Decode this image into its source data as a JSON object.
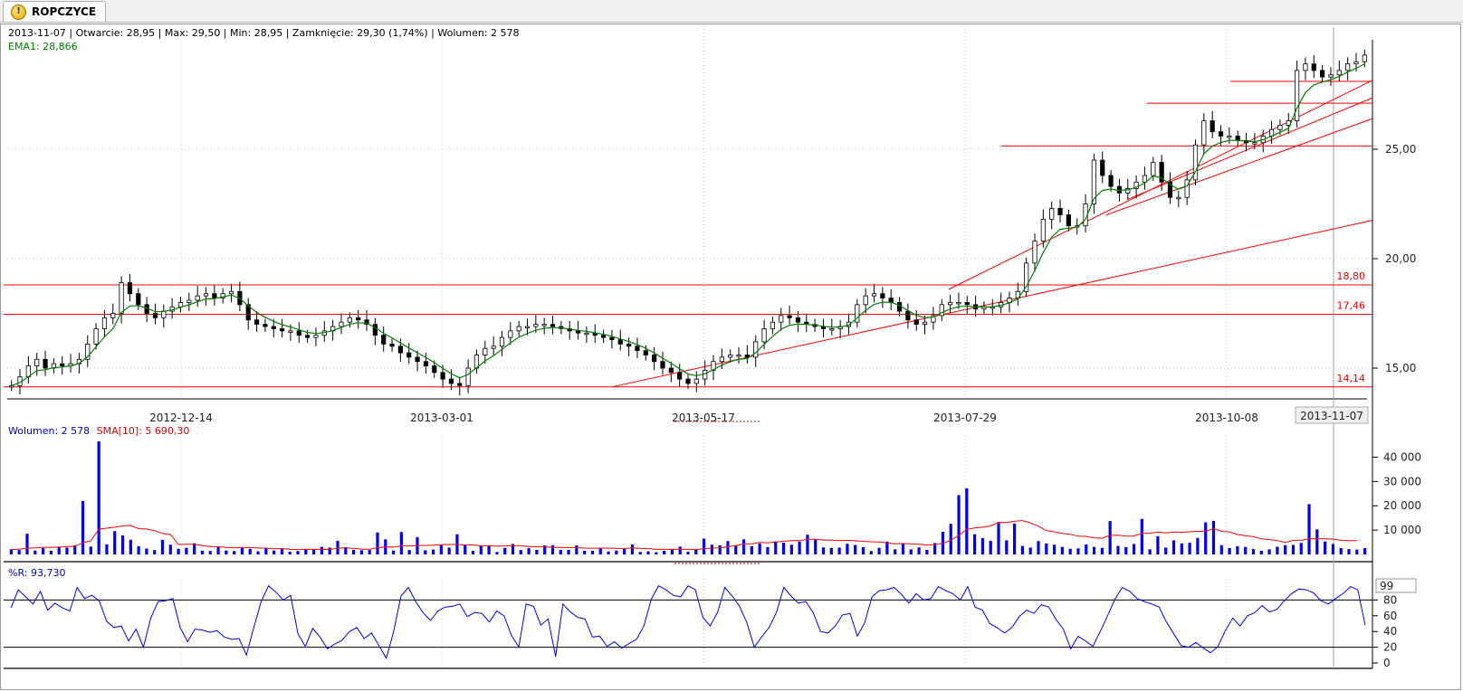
{
  "tab": {
    "icon": "warning-icon",
    "title": "ROPCZYCE"
  },
  "price_info": "2013-11-07 | Otwarcie: 28,95 | Max: 29,50 | Min: 28,95 | Zamknięcie: 29,30 (1,74%) | Wolumen: 2 578",
  "ema_label": "EMA1: 28,866",
  "volume_info": {
    "volume": "Wolumen: 2 578",
    "sma": "SMA[10]: 5 690,30"
  },
  "wr_label": "%R: 93,730",
  "wr_current_box": "99",
  "colors": {
    "ema": "#008000",
    "lines": "#ff0000",
    "volume": "#0000ee",
    "sma": "#ff0000",
    "wr": "#0000ee"
  },
  "chart_data": [
    {
      "type": "candlestick",
      "title": "ROPCZYCE",
      "x_dates": [
        "2012-12-14",
        "2013-03-01",
        "2013-05-17",
        "2013-07-29",
        "2013-10-08",
        "2013-11-07"
      ],
      "y_ticks": [
        "15,00",
        "20,00",
        "25,00"
      ],
      "ylim": [
        13.3,
        30.8
      ],
      "levels": [
        {
          "value": 18.8,
          "label": "18,80"
        },
        {
          "value": 17.46,
          "label": "17,46"
        },
        {
          "value": 14.14,
          "label": "14,14"
        }
      ],
      "close": [
        14.2,
        14.6,
        15.1,
        15.4,
        15.0,
        15.2,
        15.1,
        15.2,
        15.4,
        16.1,
        16.8,
        17.3,
        17.5,
        18.9,
        18.4,
        17.9,
        17.5,
        17.3,
        17.6,
        17.8,
        18.0,
        18.1,
        18.3,
        18.4,
        18.2,
        18.4,
        18.5,
        17.9,
        17.2,
        17.0,
        16.9,
        16.8,
        16.7,
        16.7,
        16.5,
        16.4,
        16.5,
        16.7,
        16.9,
        17.1,
        17.3,
        17.2,
        17.0,
        16.5,
        16.1,
        16.0,
        15.7,
        15.5,
        15.3,
        15.1,
        14.8,
        14.5,
        14.3,
        14.2,
        15.0,
        15.6,
        15.9,
        16.0,
        16.4,
        16.7,
        16.9,
        16.9,
        17.0,
        17.0,
        16.9,
        16.8,
        16.7,
        16.6,
        16.6,
        16.5,
        16.4,
        16.3,
        16.1,
        16.0,
        15.8,
        15.6,
        15.3,
        15.0,
        14.8,
        14.5,
        14.3,
        14.5,
        14.9,
        15.3,
        15.5,
        15.6,
        15.6,
        15.5,
        16.2,
        16.8,
        17.1,
        17.4,
        17.3,
        17.1,
        17.0,
        16.9,
        16.8,
        16.8,
        16.9,
        17.1,
        17.9,
        18.3,
        18.4,
        18.2,
        18.0,
        17.6,
        17.2,
        17.0,
        17.1,
        17.4,
        17.9,
        18.0,
        18.0,
        17.9,
        17.7,
        17.8,
        17.8,
        18.0,
        18.2,
        18.5,
        19.8,
        20.8,
        21.8,
        22.3,
        22.0,
        21.5,
        21.5,
        22.5,
        24.5,
        23.8,
        23.3,
        23.0,
        23.2,
        23.5,
        23.8,
        24.4,
        23.5,
        22.8,
        22.8,
        23.6,
        25.2,
        26.3,
        25.8,
        25.6,
        25.6,
        25.4,
        25.3,
        25.3,
        25.6,
        25.9,
        26.1,
        26.3,
        28.6,
        28.9,
        28.6,
        28.3,
        28.4,
        28.6,
        28.9,
        29.0,
        29.3
      ],
      "indicator": {
        "name": "EMA1",
        "last": 28.866
      }
    },
    {
      "type": "bar",
      "title": "Wolumen",
      "y_ticks": [
        "10 000",
        "20 000",
        "30 000",
        "40 000"
      ],
      "ylim": [
        0,
        46500
      ],
      "values": [
        2100,
        1800,
        8500,
        1600,
        2600,
        1500,
        3100,
        2800,
        3700,
        22000,
        3200,
        48000,
        4100,
        9600,
        7800,
        6000,
        3400,
        2400,
        1800,
        6000,
        4000,
        2300,
        2700,
        4600,
        1500,
        1400,
        3000,
        1600,
        1400,
        3000,
        2300,
        1300,
        2800,
        1600,
        2400,
        1100,
        1400,
        2100,
        2000,
        3100,
        2800,
        5600,
        3000,
        1900,
        1700,
        1800,
        9000,
        6200,
        1600,
        9200,
        1800,
        7100,
        1700,
        2000,
        3800,
        2800,
        8300,
        4000,
        1500,
        3700,
        3500,
        1000,
        2700,
        4300,
        1800,
        2600,
        1900,
        3700,
        3800,
        1900,
        1900,
        3700,
        1500,
        1500,
        2600,
        1200,
        1600,
        2200,
        4100,
        1000,
        1300,
        900,
        1500,
        2200,
        3200,
        1100,
        1900,
        6500,
        4000,
        3800,
        5500,
        3700,
        6200,
        3400,
        4500,
        3000,
        5400,
        4800,
        4000,
        5300,
        8100,
        6300,
        2900,
        2700,
        2800,
        4400,
        3900,
        3000,
        1400,
        2700,
        5300,
        2100,
        4300,
        2100,
        2900,
        1900,
        4700,
        9300,
        12600,
        24400,
        27200,
        8300,
        6700,
        5600,
        13300,
        5800,
        12700,
        3500,
        2800,
        5500,
        4500,
        4000,
        3100,
        2300,
        2500,
        4100,
        3100,
        2700,
        13700,
        3500,
        3000,
        4300,
        14600,
        2100,
        7500,
        2800,
        5800,
        4500,
        4800,
        6800,
        13200,
        13800,
        3800,
        2600,
        3400,
        3100,
        2200,
        1500,
        2100,
        3200,
        3800,
        3900,
        4700,
        20700,
        10300,
        5300,
        4300,
        2600,
        2200,
        2000,
        2600
      ],
      "series": [
        {
          "name": "SMA[10]",
          "last": 5690.3
        }
      ],
      "sma_values": [
        2000,
        2200,
        2500,
        2700,
        2900,
        2900,
        3000,
        3200,
        3400,
        4800,
        5600,
        10400,
        10800,
        11200,
        11700,
        11900,
        10600,
        10400,
        9800,
        8600,
        8200,
        4100,
        4200,
        4200,
        3600,
        3200,
        3200,
        2900,
        2700,
        2900,
        2800,
        2600,
        2600,
        2300,
        2400,
        2100,
        2000,
        2100,
        2100,
        2100,
        2000,
        2600,
        2700,
        2500,
        2200,
        2100,
        2800,
        3100,
        3000,
        3500,
        3500,
        3700,
        3700,
        3800,
        4000,
        4100,
        4100,
        3900,
        3900,
        3500,
        3600,
        3400,
        3500,
        3700,
        3500,
        3200,
        3200,
        3100,
        2900,
        2900,
        2800,
        2800,
        2600,
        2500,
        2600,
        2600,
        2500,
        2400,
        2700,
        2500,
        2400,
        2100,
        2100,
        2100,
        2100,
        2100,
        2000,
        2300,
        2600,
        2700,
        3200,
        3600,
        4300,
        4400,
        4900,
        4800,
        5100,
        5400,
        5700,
        5700,
        6200,
        6200,
        5900,
        5900,
        5700,
        5800,
        5600,
        5400,
        5200,
        5100,
        4800,
        4400,
        4500,
        4300,
        4200,
        3900,
        4000,
        4600,
        5800,
        7800,
        10300,
        10900,
        11200,
        11700,
        13100,
        13100,
        13700,
        13900,
        13000,
        11600,
        9800,
        9300,
        8600,
        8300,
        7500,
        7400,
        6800,
        6700,
        7800,
        7900,
        7500,
        7600,
        8700,
        8700,
        9200,
        8800,
        9200,
        9100,
        9300,
        9500,
        9500,
        10600,
        9500,
        9300,
        8200,
        7700,
        7300,
        6400,
        6100,
        5700,
        4900,
        5800,
        5800,
        6400,
        6500,
        6400,
        6300,
        5800,
        5700,
        5700
      ]
    },
    {
      "type": "line",
      "title": "%R",
      "y_ticks": [
        "0",
        "20",
        "40",
        "60",
        "80"
      ],
      "ylim": [
        0,
        102
      ],
      "series": [
        {
          "name": "%R",
          "last": 93.73
        }
      ],
      "values": [
        70,
        93,
        84,
        75,
        91,
        67,
        76,
        70,
        66,
        96,
        82,
        86,
        79,
        53,
        45,
        47,
        28,
        43,
        20,
        57,
        78,
        79,
        82,
        45,
        27,
        43,
        42,
        39,
        41,
        33,
        30,
        31,
        10,
        45,
        78,
        98,
        90,
        80,
        86,
        37,
        21,
        44,
        33,
        18,
        24,
        29,
        40,
        45,
        31,
        38,
        22,
        6,
        40,
        85,
        96,
        78,
        64,
        54,
        66,
        71,
        72,
        75,
        59,
        64,
        63,
        52,
        66,
        60,
        35,
        20,
        75,
        72,
        48,
        56,
        8,
        75,
        65,
        58,
        56,
        33,
        34,
        21,
        27,
        19,
        25,
        30,
        47,
        81,
        98,
        93,
        86,
        84,
        98,
        93,
        58,
        47,
        64,
        96,
        85,
        72,
        51,
        20,
        33,
        45,
        64,
        96,
        85,
        76,
        78,
        64,
        40,
        38,
        47,
        61,
        63,
        34,
        51,
        84,
        92,
        93,
        96,
        87,
        76,
        88,
        80,
        82,
        97,
        92,
        88,
        80,
        97,
        71,
        67,
        50,
        45,
        38,
        45,
        59,
        67,
        63,
        74,
        71,
        55,
        43,
        18,
        34,
        28,
        21,
        40,
        60,
        81,
        96,
        91,
        82,
        78,
        75,
        71,
        52,
        37,
        22,
        20,
        26,
        19,
        13,
        21,
        41,
        57,
        47,
        60,
        64,
        73,
        65,
        68,
        79,
        88,
        94,
        93,
        89,
        79,
        75,
        82,
        88,
        97,
        93,
        48
      ]
    }
  ]
}
